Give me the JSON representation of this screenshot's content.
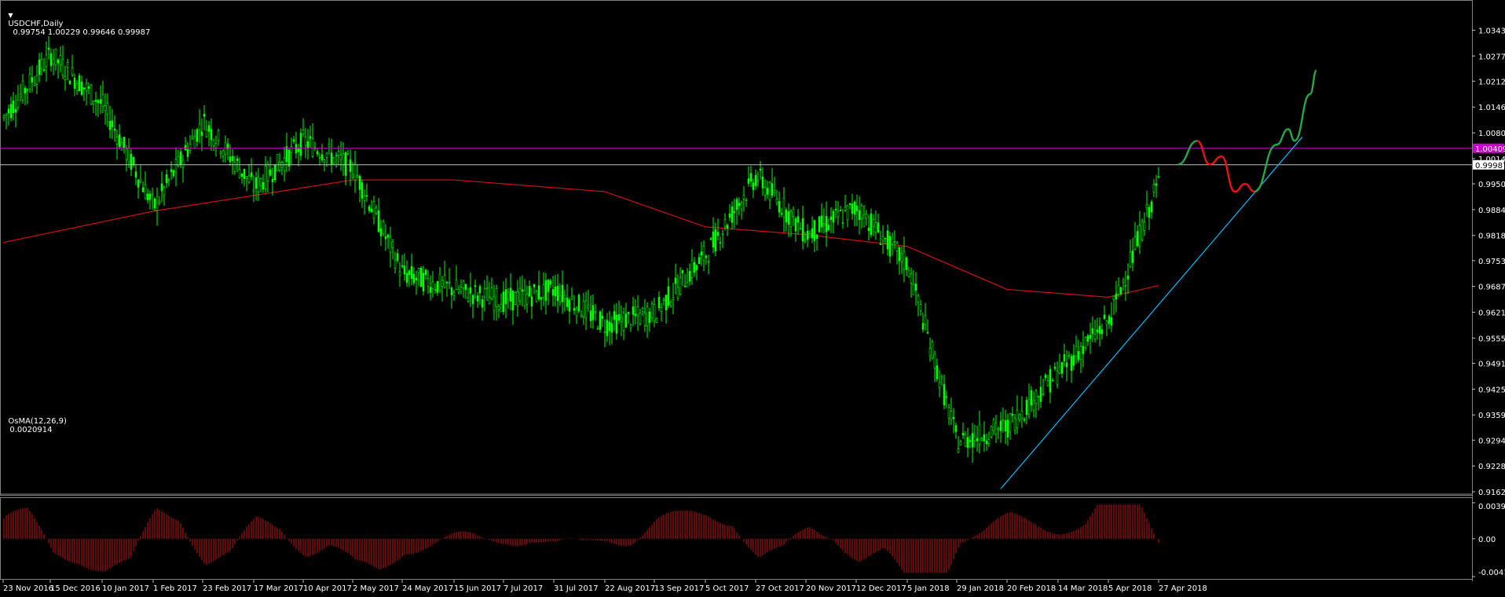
{
  "window": {
    "title": "USDCHF,Daily",
    "ohlc": "0.99754 1.00229 0.99646 0.99987",
    "menu_arrow": "down-triangle-icon"
  },
  "indicator": {
    "title": "OsMA(12,26,9)",
    "value": "0.0020914",
    "ticks": [
      "0.003963",
      "0.00",
      "-0.004163"
    ]
  },
  "price_axis": {
    "ticks": [
      "1.03430",
      "1.02770",
      "1.02125",
      "1.01465",
      "1.00805",
      "1.00145",
      "0.99500",
      "0.98840",
      "0.98180",
      "0.97535",
      "0.96875",
      "0.96215",
      "0.95555",
      "0.94910",
      "0.94250",
      "0.93590",
      "0.92945",
      "0.92285",
      "0.91625"
    ],
    "magenta_tag": "1.00409",
    "current_tag": "0.99987"
  },
  "time_axis": {
    "labels": [
      "23 Nov 2016",
      "15 Dec 2016",
      "10 Jan 2017",
      "1 Feb 2017",
      "23 Feb 2017",
      "17 Mar 2017",
      "10 Apr 2017",
      "2 May 2017",
      "24 May 2017",
      "15 Jun 2017",
      "7 Jul 2017",
      "31 Jul 2017",
      "22 Aug 2017",
      "13 Sep 2017",
      "5 Oct 2017",
      "27 Oct 2017",
      "20 Nov 2017",
      "12 Dec 2017",
      "5 Jan 2018",
      "29 Jan 2018",
      "20 Feb 2018",
      "14 Mar 2018",
      "5 Apr 2018",
      "27 Apr 2018"
    ]
  },
  "colors": {
    "background": "#000000",
    "candle": "#00ff00",
    "ma": "#d01010",
    "hline_magenta": "#cc00cc",
    "hline_grey": "#c0c0c0",
    "trendline": "#00bfff",
    "path_green": "#22aa44",
    "path_red": "#ee1111",
    "osma_bar": "#cc1010"
  },
  "chart_data": {
    "type": "candlestick",
    "symbol": "USDCHF",
    "timeframe": "Daily",
    "ylim": [
      0.91625,
      1.0376
    ],
    "anchors": [
      {
        "date": "23 Nov 2016",
        "close": 1.012
      },
      {
        "date": "15 Dec 2016",
        "close": 1.028
      },
      {
        "date": "10 Jan 2017",
        "close": 1.015
      },
      {
        "date": "1 Feb 2017",
        "close": 0.989
      },
      {
        "date": "23 Feb 2017",
        "close": 1.011
      },
      {
        "date": "17 Mar 2017",
        "close": 0.994
      },
      {
        "date": "10 Apr 2017",
        "close": 1.006
      },
      {
        "date": "2 May 2017",
        "close": 0.999
      },
      {
        "date": "24 May 2017",
        "close": 0.972
      },
      {
        "date": "15 Jun 2017",
        "close": 0.968
      },
      {
        "date": "7 Jul 2017",
        "close": 0.965
      },
      {
        "date": "31 Jul 2017",
        "close": 0.968
      },
      {
        "date": "22 Aug 2017",
        "close": 0.959
      },
      {
        "date": "13 Sep 2017",
        "close": 0.962
      },
      {
        "date": "5 Oct 2017",
        "close": 0.977
      },
      {
        "date": "27 Oct 2017",
        "close": 0.997
      },
      {
        "date": "20 Nov 2017",
        "close": 0.982
      },
      {
        "date": "12 Dec 2017",
        "close": 0.989
      },
      {
        "date": "5 Jan 2018",
        "close": 0.974
      },
      {
        "date": "29 Jan 2018",
        "close": 0.929
      },
      {
        "date": "20 Feb 2018",
        "close": 0.933
      },
      {
        "date": "14 Mar 2018",
        "close": 0.947
      },
      {
        "date": "5 Apr 2018",
        "close": 0.96
      },
      {
        "date": "27 Apr 2018",
        "close": 0.996
      }
    ],
    "moving_average": [
      {
        "date": "23 Nov 2016",
        "value": 0.98
      },
      {
        "date": "1 Feb 2017",
        "value": 0.988
      },
      {
        "date": "10 Apr 2017",
        "value": 0.994
      },
      {
        "date": "2 May 2017",
        "value": 0.996
      },
      {
        "date": "15 Jun 2017",
        "value": 0.996
      },
      {
        "date": "22 Aug 2017",
        "value": 0.993
      },
      {
        "date": "5 Oct 2017",
        "value": 0.984
      },
      {
        "date": "20 Nov 2017",
        "value": 0.982
      },
      {
        "date": "5 Jan 2018",
        "value": 0.979
      },
      {
        "date": "20 Feb 2018",
        "value": 0.968
      },
      {
        "date": "5 Apr 2018",
        "value": 0.966
      },
      {
        "date": "27 Apr 2018",
        "value": 0.969
      }
    ],
    "horizontal_lines": [
      1.00409,
      0.99987
    ],
    "trendline": {
      "start": {
        "date": "29 Jan 2018",
        "value": 0.917
      },
      "end_value": 1.007
    },
    "projection": {
      "segments": [
        {
          "color": "green",
          "points": [
            1.0,
            1.006
          ]
        },
        {
          "color": "red",
          "points": [
            1.006,
            1.0,
            1.002,
            0.993,
            0.995,
            0.993
          ]
        },
        {
          "color": "green",
          "points": [
            0.993,
            1.005,
            1.009,
            1.006,
            1.018,
            1.024
          ]
        }
      ]
    },
    "osma_ylim": [
      -0.004163,
      0.003963
    ]
  }
}
